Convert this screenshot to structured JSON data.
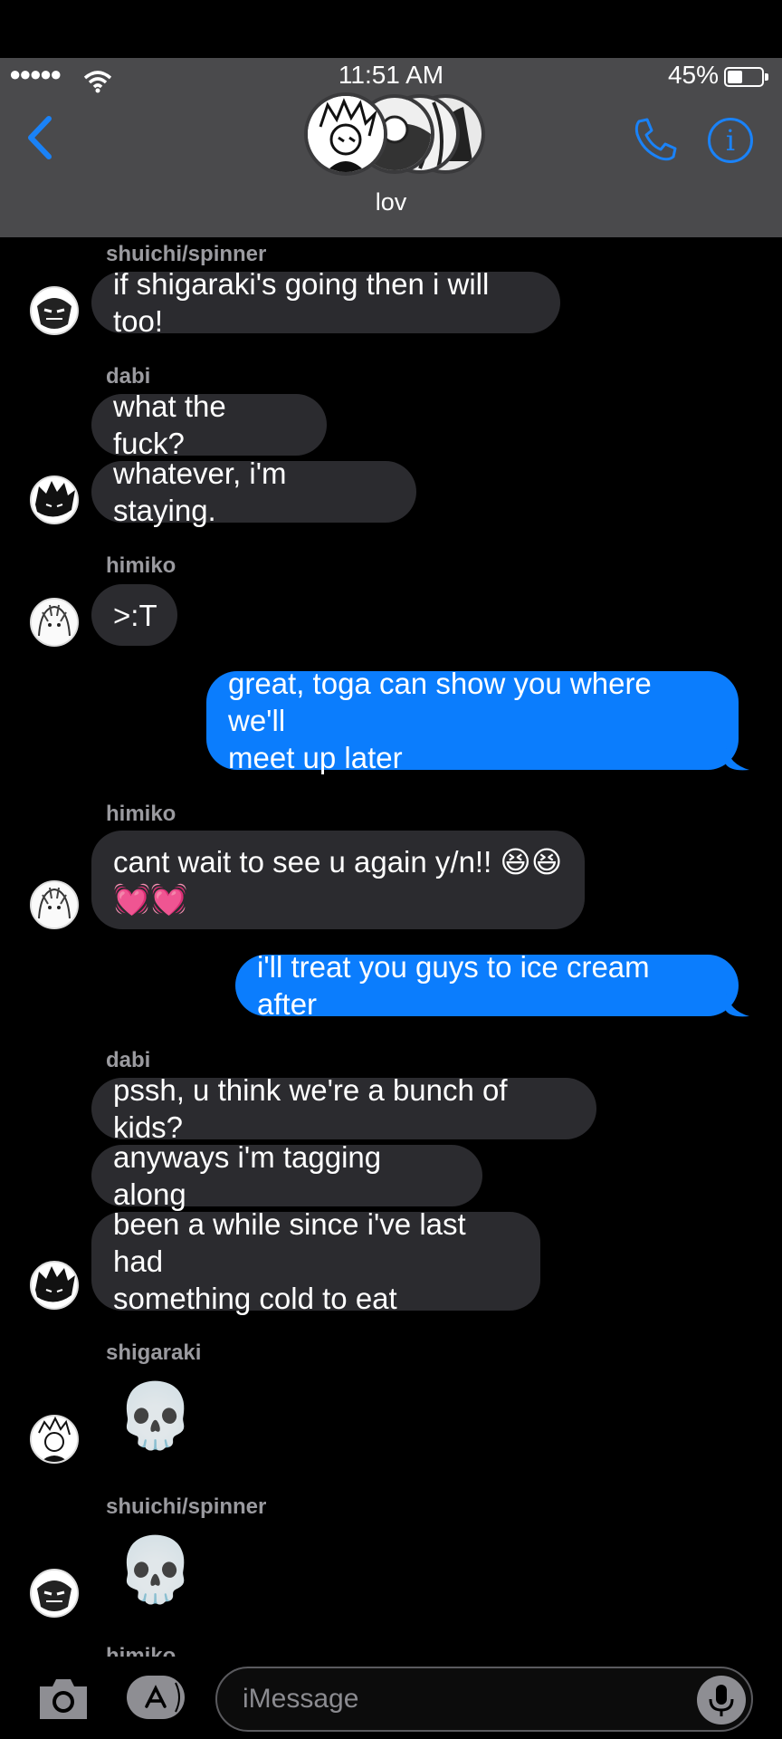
{
  "status_bar": {
    "signal": "●●●●●",
    "time": "11:51 AM",
    "battery_percent": "45%",
    "battery_level": 0.45
  },
  "header": {
    "back_icon": "chevron-left-icon",
    "group_name": "lov",
    "phone_icon": "phone-icon",
    "info_icon": "info-icon",
    "info_glyph": "i"
  },
  "conversation": {
    "senders": {
      "s1": "shuichi/spinner",
      "s2": "dabi",
      "s3": "himiko",
      "s4": "himiko",
      "s5": "dabi",
      "s6": "shigaraki",
      "s7": "shuichi/spinner",
      "s8": "himiko"
    },
    "messages": {
      "m1": "if shigaraki's going then i will too!",
      "m2": "what the fuck?",
      "m3": "whatever, i'm staying.",
      "m4": ">:T",
      "m5": "great, toga can show you where we'll\nmeet up later",
      "m6": "cant wait to see u again y/n!! 😆😆\n💓💓",
      "m7": "i'll treat you guys to ice cream after",
      "m8": "pssh, u think we're a bunch of kids?",
      "m9": "anyways i'm tagging along",
      "m10": "been a while since i've last had\nsomething cold to eat",
      "m11": "💀",
      "m12": "💀"
    }
  },
  "composer": {
    "placeholder": "iMessage",
    "camera_icon": "camera-icon",
    "appstore_icon": "appstore-icon",
    "mic_icon": "microphone-icon"
  },
  "colors": {
    "outgoing_bubble": "#0b7dfd",
    "incoming_bubble": "#2b2b2f",
    "accent": "#1a82f7",
    "header_bg": "#4a4a4c"
  }
}
